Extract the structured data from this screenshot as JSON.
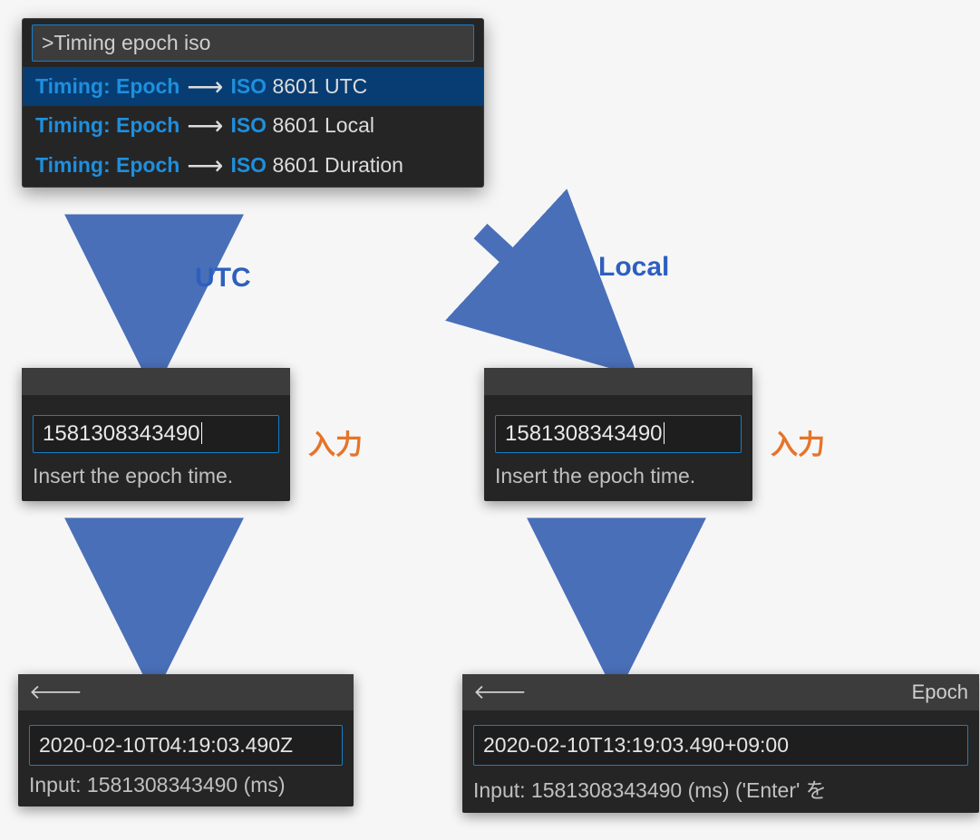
{
  "palette": {
    "query": ">Timing epoch iso",
    "items": [
      {
        "prefix": "Timing:",
        "epoch": "Epoch",
        "iso": "ISO",
        "suffix": "8601 UTC"
      },
      {
        "prefix": "Timing:",
        "epoch": "Epoch",
        "iso": "ISO",
        "suffix": "8601 Local"
      },
      {
        "prefix": "Timing:",
        "epoch": "Epoch",
        "iso": "ISO",
        "suffix": "8601 Duration"
      }
    ]
  },
  "flow_labels": {
    "utc": "UTC",
    "local": "Local"
  },
  "side_labels": {
    "input": "入力"
  },
  "epoch_input": {
    "value": "1581308343490",
    "hint": "Insert the epoch time."
  },
  "result_utc": {
    "value": "2020-02-10T04:19:03.490Z",
    "hint": "Input: 1581308343490 (ms)"
  },
  "result_local": {
    "header_right": "Epoch",
    "value": "2020-02-10T13:19:03.490+09:00",
    "hint": "Input: 1581308343490 (ms) ('Enter' を"
  }
}
